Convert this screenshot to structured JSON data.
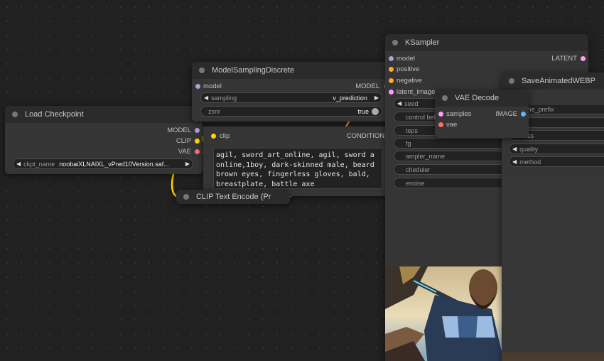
{
  "colors": {
    "model": "#b39ddb",
    "clip": "#ffd500",
    "vae": "#ff6e6e",
    "latent": "#ff9cf9",
    "conditioning": "#ffa931",
    "image": "#64b5f6"
  },
  "load_checkpoint": {
    "title": "Load Checkpoint",
    "outputs": [
      "MODEL",
      "CLIP",
      "VAE"
    ],
    "ckpt_label": "ckpt_name",
    "ckpt_value": "noobaiXLNAIXL_vPred10Version.saf..."
  },
  "model_sampling": {
    "title": "ModelSamplingDiscrete",
    "input": "model",
    "output": "MODEL",
    "sampling_label": "sampling",
    "sampling_value": "v_prediction",
    "zsnr_label": "zsnr",
    "zsnr_value": "true"
  },
  "clip_text": {
    "title": "CLIP Text Encode (Pr",
    "input": "clip",
    "output": "CONDITIONING",
    "prompt": "agil, sword_art_online, agil, sword a\nonline,1boy, dark-skinned male, beard\nbrown eyes, fingerless gloves, bald,\nbreastplate, battle axe"
  },
  "ksampler": {
    "title": "KSampler",
    "inputs": [
      "model",
      "positive",
      "negative",
      "latent_image"
    ],
    "output": "LATENT",
    "w_seed": "seed",
    "w_control": "control bef",
    "w_steps": "teps",
    "w_cfg": "fg",
    "w_sampler": "ampler_name",
    "w_scheduler": "cheduler",
    "w_denoise": "enoise"
  },
  "vae_decode": {
    "title": "VAE Decode",
    "inputs": [
      "samples",
      "vae"
    ],
    "output": "IMAGE"
  },
  "save_webp": {
    "title": "SaveAnimatedWEBP",
    "images_label": "es",
    "w_prefix": "ame_prefix",
    "w_lossless": "less",
    "w_quality": "quality",
    "w_method": "method"
  }
}
